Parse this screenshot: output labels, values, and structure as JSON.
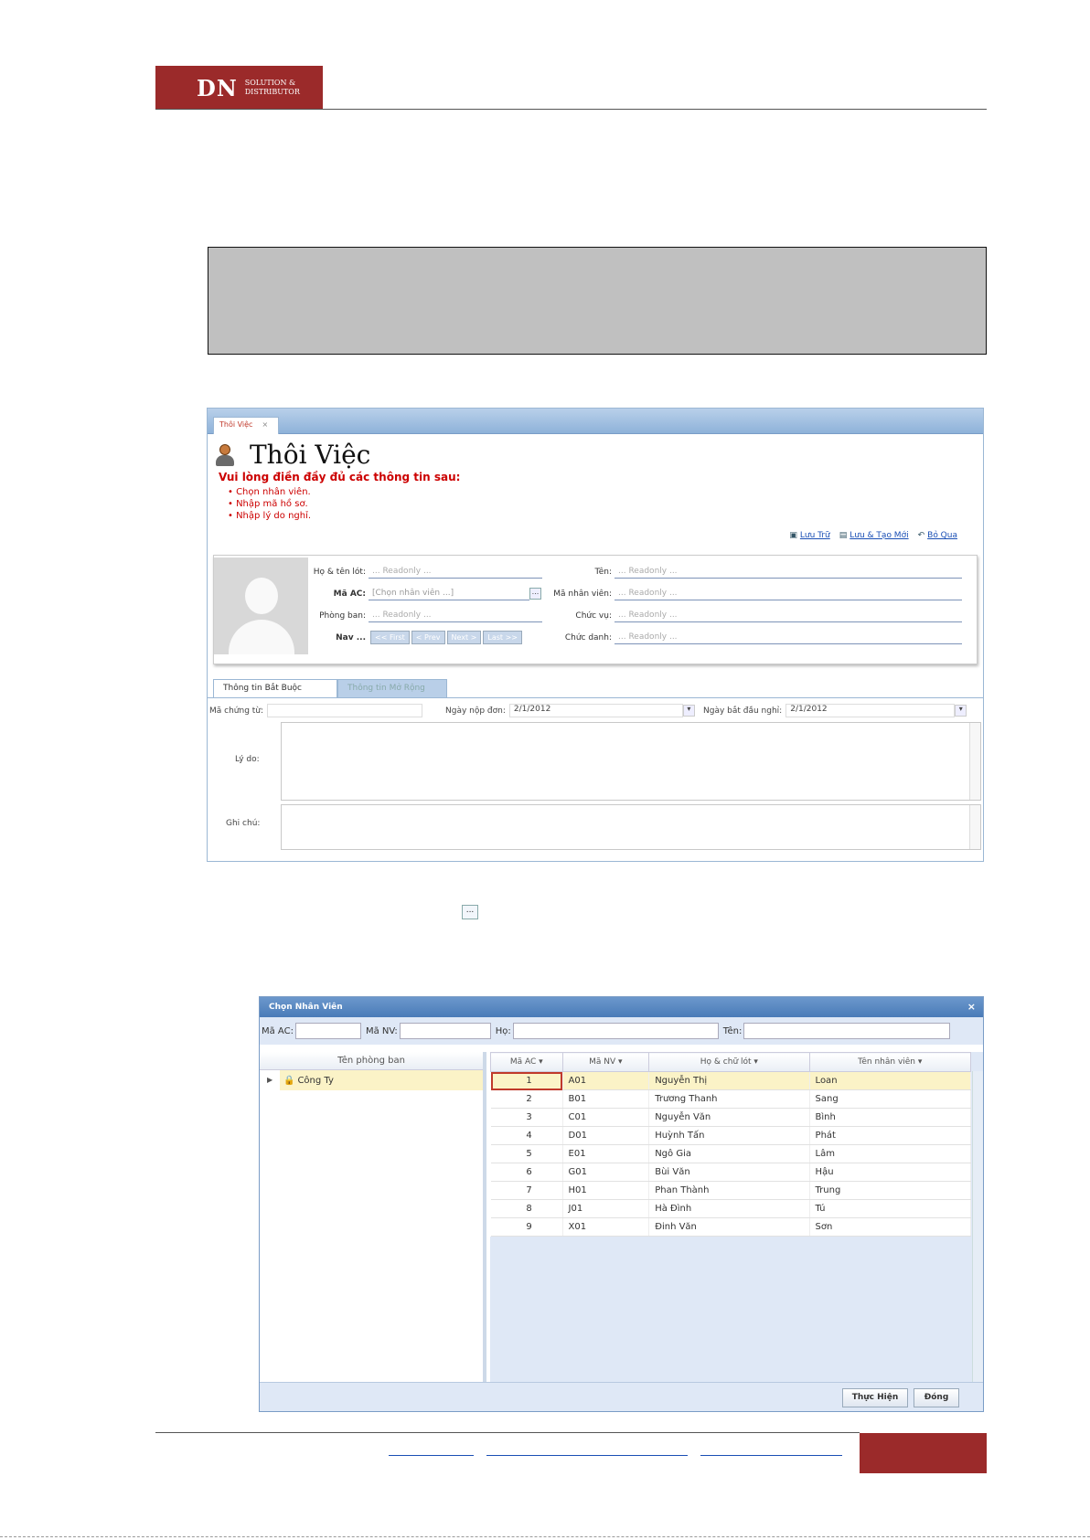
{
  "logo": {
    "mark": "DN",
    "line1": "SOLUTION &",
    "line2": "DISTRIBUTOR"
  },
  "screen1": {
    "tab_label": "Thôi Việc",
    "tab_close": "×",
    "title": "Thôi Việc",
    "warning": "Vui lòng điền đầy đủ các thông tin sau:",
    "bullets": [
      "Chọn nhân viên.",
      "Nhập mã hồ sơ.",
      "Nhập lý do nghỉ."
    ],
    "actions": [
      {
        "icon": "save-icon",
        "glyph": "▣",
        "label": "Lưu Trữ"
      },
      {
        "icon": "save-new-icon",
        "glyph": "▤",
        "label": "Lưu & Tạo Mới"
      },
      {
        "icon": "undo-icon",
        "glyph": "↶",
        "label": "Bỏ Qua"
      }
    ],
    "fields": {
      "ho_ten_label": "Họ & tên lót:",
      "ho_ten_placeholder": "... Readonly ...",
      "ten_label": "Tên:",
      "ten_placeholder": "... Readonly ...",
      "ma_ac_label": "Mã AC:",
      "ma_ac_placeholder": "[Chọn nhân viên ...]",
      "ma_nv_label": "Mã nhân viên:",
      "ma_nv_placeholder": "... Readonly ...",
      "phong_ban_label": "Phòng ban:",
      "phong_ban_placeholder": "... Readonly ...",
      "chuc_vu_label": "Chức vụ:",
      "chuc_vu_placeholder": "... Readonly ...",
      "nav_label": "Nav ...",
      "nav_buttons": [
        "<< First",
        "< Prev",
        "Next >",
        "Last >>"
      ],
      "chuc_danh_label": "Chức danh:",
      "chuc_danh_placeholder": "... Readonly ..."
    },
    "tabs": [
      "Thông tin Bắt Buộc",
      "Thông tin Mở Rộng"
    ],
    "form": {
      "ma_chung_tu_label": "Mã chứng từ:",
      "ngay_nop_label": "Ngày nộp đơn:",
      "ngay_nop_value": "2/1/2012",
      "ngay_bat_dau_label": "Ngày bắt đầu nghỉ:",
      "ngay_bat_dau_value": "2/1/2012",
      "ly_do_label": "Lý do:",
      "ghi_chu_label": "Ghi chú:"
    }
  },
  "inline_icon": "...",
  "dialog": {
    "title": "Chọn Nhân Viên",
    "close": "×",
    "filters": {
      "ma_ac": "Mã AC:",
      "ma_nv": "Mã NV:",
      "ho": "Họ:",
      "ten": "Tên:"
    },
    "tree_header": "Tên phòng ban",
    "tree_root": "Công Ty",
    "columns": [
      "Mã AC",
      "Mã NV",
      "Họ & chữ lót",
      "Tên nhân viên"
    ],
    "rows": [
      {
        "ac": "1",
        "nv": "A01",
        "ho": "Nguyễn Thị",
        "ten": "Loan"
      },
      {
        "ac": "2",
        "nv": "B01",
        "ho": "Trương Thanh",
        "ten": "Sang"
      },
      {
        "ac": "3",
        "nv": "C01",
        "ho": "Nguyễn Văn",
        "ten": "Bình"
      },
      {
        "ac": "4",
        "nv": "D01",
        "ho": "Huỳnh Tấn",
        "ten": "Phát"
      },
      {
        "ac": "5",
        "nv": "E01",
        "ho": "Ngô Gia",
        "ten": "Lâm"
      },
      {
        "ac": "6",
        "nv": "G01",
        "ho": "Bùi Văn",
        "ten": "Hậu"
      },
      {
        "ac": "7",
        "nv": "H01",
        "ho": "Phan Thành",
        "ten": "Trung"
      },
      {
        "ac": "8",
        "nv": "J01",
        "ho": "Hà Đình",
        "ten": "Tú"
      },
      {
        "ac": "9",
        "nv": "X01",
        "ho": "Đinh Văn",
        "ten": "Sơn"
      }
    ],
    "btn_ok": "Thực Hiện",
    "btn_close": "Đóng"
  }
}
